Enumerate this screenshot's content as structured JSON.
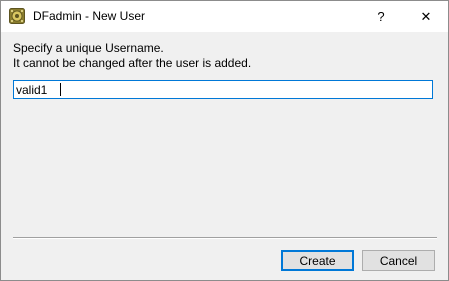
{
  "window": {
    "title": "DFadmin - New User",
    "help_label": "?",
    "close_label": "✕",
    "icon": "dfadmin-app-icon"
  },
  "dialog": {
    "prompt_line1": "Specify a unique Username.",
    "prompt_line2": "It cannot be changed after the user is added.",
    "username_value": "valid1"
  },
  "buttons": {
    "create_label": "Create",
    "cancel_label": "Cancel"
  },
  "colors": {
    "focus_accent": "#0078d7",
    "window_bg": "#f0f0f0",
    "titlebar_bg": "#ffffff"
  }
}
